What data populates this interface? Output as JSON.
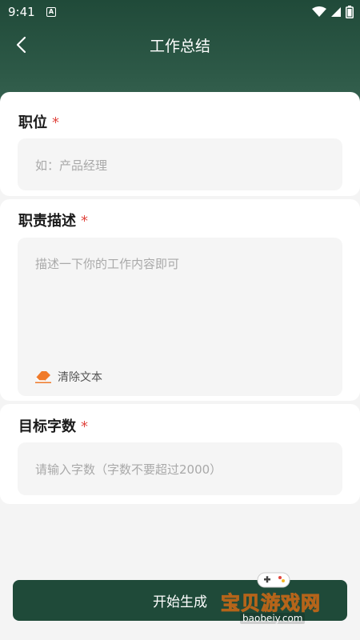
{
  "status_bar": {
    "time": "9:41",
    "notification_letter": "A"
  },
  "nav": {
    "title": "工作总结"
  },
  "position_card": {
    "label": "职位",
    "required_mark": "*",
    "placeholder": "如：产品经理"
  },
  "duties_card": {
    "label": "职责描述",
    "required_mark": "*",
    "placeholder": "描述一下你的工作内容即可",
    "clear_label": "清除文本"
  },
  "wordcount_card": {
    "label": "目标字数",
    "required_mark": "*",
    "placeholder": "请输入字数（字数不要超过2000）"
  },
  "submit": {
    "label": "开始生成"
  },
  "watermark": {
    "text": "宝贝游戏网",
    "url": "baobeiy.com"
  },
  "colors": {
    "header": "#204a39",
    "button": "#1f4a39",
    "required": "#e0463f",
    "eraser_icon": "#f07a2a"
  }
}
